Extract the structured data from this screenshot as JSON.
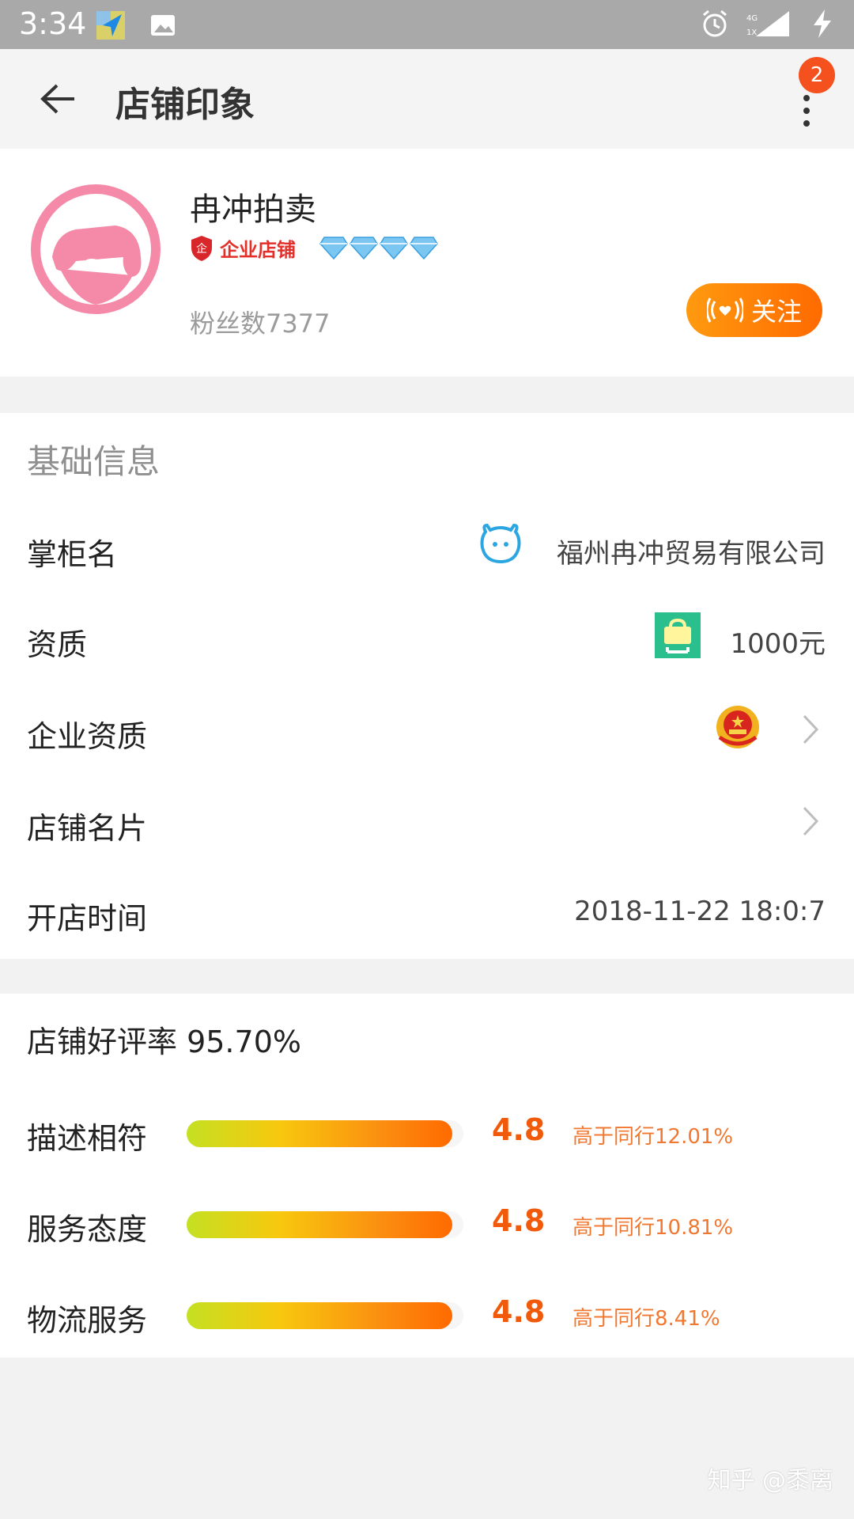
{
  "status_bar": {
    "time": "3:34",
    "network_label": "4G",
    "sim_label": "1X"
  },
  "header": {
    "title": "店铺印象",
    "badge_count": "2"
  },
  "store": {
    "name": "冉冲拍卖",
    "badge_text": "企业店铺",
    "badge_char": "企",
    "diamonds": 4,
    "fans": "粉丝数7377",
    "follow_label": "关注"
  },
  "basic_info": {
    "title": "基础信息",
    "rows": [
      {
        "label": "掌柜名",
        "value": "福州冉冲贸易有限公司",
        "icon": "wangwang-chat-icon"
      },
      {
        "label": "资质",
        "value": "1000元",
        "icon": "deposit-bag-icon"
      },
      {
        "label": "企业资质",
        "value": "",
        "icon": "national-emblem-icon"
      },
      {
        "label": "店铺名片",
        "value": "",
        "icon": ""
      },
      {
        "label": "开店时间",
        "value": "2018-11-22 18:0:7",
        "icon": ""
      }
    ]
  },
  "rating": {
    "title": "店铺好评率 95.70%",
    "metrics": [
      {
        "label": "描述相符",
        "score": "4.8",
        "compare": "高于同行12.01%",
        "fill": 0.96
      },
      {
        "label": "服务态度",
        "score": "4.8",
        "compare": "高于同行10.81%",
        "fill": 0.96
      },
      {
        "label": "物流服务",
        "score": "4.8",
        "compare": "高于同行8.41%",
        "fill": 0.96
      }
    ]
  },
  "watermark": "知乎 @黍离",
  "colors": {
    "accent": "#ff6a00",
    "score": "#f05a0a",
    "badge": "#f4511e",
    "enterprise_red": "#e4302a",
    "avatar_pink": "#f489a8"
  }
}
